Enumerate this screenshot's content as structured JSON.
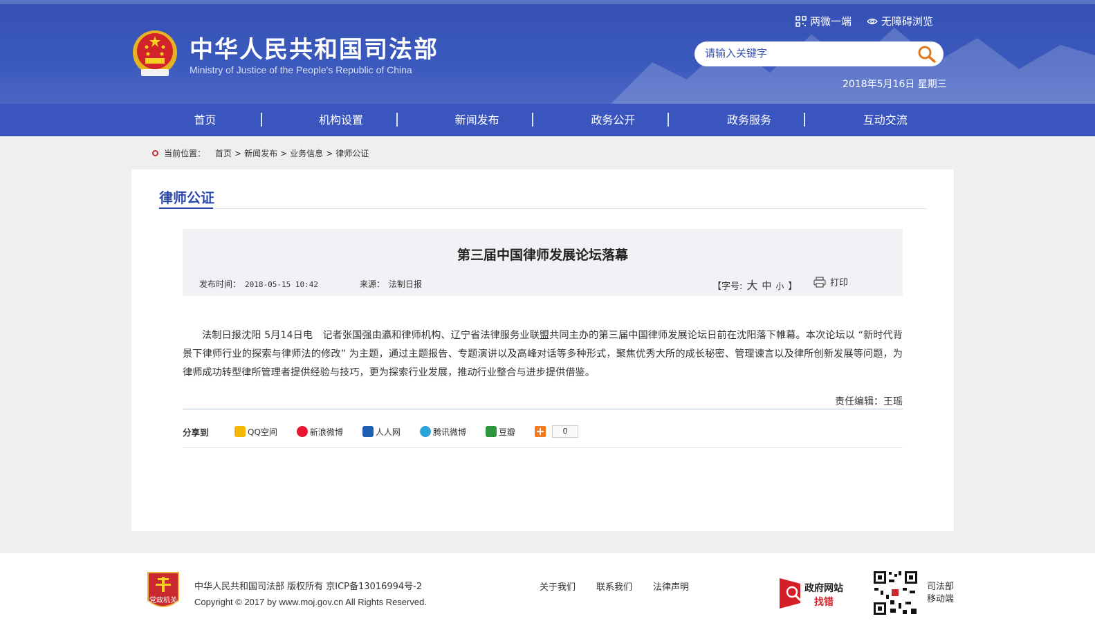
{
  "header": {
    "title": "中华人民共和国司法部",
    "subtitle": "Ministry of Justice of the People's Republic of China",
    "links": [
      {
        "label": "两微一端",
        "icon": "qr-grid-icon"
      },
      {
        "label": "无障碍浏览",
        "icon": "eye-icon"
      }
    ],
    "search": {
      "placeholder": "请输入关键字"
    },
    "date": "2018年5月16日 星期三"
  },
  "nav": {
    "items": [
      "首页",
      "机构设置",
      "新闻发布",
      "政务公开",
      "政务服务",
      "互动交流"
    ]
  },
  "breadcrumb": {
    "prefix": "当前位置：",
    "items": [
      "首页",
      "新闻发布",
      "业务信息",
      "律师公证"
    ],
    "separator": ">"
  },
  "section": {
    "title": "律师公证"
  },
  "article": {
    "title": "第三届中国律师发展论坛落幕",
    "publish_label": "发布时间：",
    "publish_time": "2018-05-15 10:42",
    "source_label": "来源：",
    "source": "法制日报",
    "fontsize_open": "【字号:",
    "fontsize_large": "大",
    "fontsize_medium": "中",
    "fontsize_small": "小",
    "fontsize_close": "】",
    "print_label": "打印",
    "body": "法制日报沈阳 5月14日电　记者张国强由瀛和律师机构、辽宁省法律服务业联盟共同主办的第三届中国律师发展论坛日前在沈阳落下帷幕。本次论坛以 “新时代背景下律师行业的探索与律师法的修改” 为主题，通过主题报告、专题演讲以及高峰对话等多种形式，聚焦优秀大所的成长秘密、管理谏言以及律所创新发展等问题，为律师成功转型律所管理者提供经验与技巧，更为探索行业发展，推动行业整合与进步提供借鉴。",
    "editor": "责任编辑：王瑶"
  },
  "share": {
    "label": "分享到",
    "items": [
      {
        "label": "QQ空间",
        "icon": "qzone-icon",
        "color": "#f5b800"
      },
      {
        "label": "新浪微博",
        "icon": "weibo-icon",
        "color": "#e6162d"
      },
      {
        "label": "人人网",
        "icon": "renren-icon",
        "color": "#1d5fb4"
      },
      {
        "label": "腾讯微博",
        "icon": "tencent-weibo-icon",
        "color": "#2aa3d8"
      },
      {
        "label": "豆瓣",
        "icon": "douban-icon",
        "color": "#2e963d"
      }
    ],
    "count": "0"
  },
  "footer": {
    "copyright_line1": "中华人民共和国司法部 版权所有 京ICP备13016994号-2",
    "copyright_line2": "Copyright © 2017 by www.moj.gov.cn All Rights Reserved.",
    "logo_text": "党政机关",
    "links": [
      "关于我们",
      "联系我们",
      "法律声明"
    ],
    "gov_line1": "政府网站",
    "gov_line2": "找错",
    "mobile_line1": "司法部",
    "mobile_line2": "移动端"
  }
}
